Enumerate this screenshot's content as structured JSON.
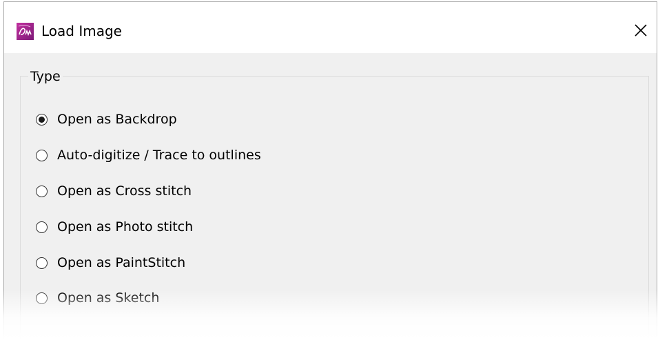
{
  "window": {
    "title": "Load Image",
    "app_icon": "bernina-app-icon",
    "close_icon": "close-icon",
    "accent_color": "#a3208f"
  },
  "type_group": {
    "legend": "Type",
    "options": [
      {
        "label": "Open as Backdrop",
        "selected": true
      },
      {
        "label": "Auto-digitize / Trace to outlines",
        "selected": false
      },
      {
        "label": "Open as Cross stitch",
        "selected": false
      },
      {
        "label": "Open as Photo stitch",
        "selected": false
      },
      {
        "label": "Open as PaintStitch",
        "selected": false
      },
      {
        "label": "Open as Sketch",
        "selected": false
      }
    ]
  }
}
